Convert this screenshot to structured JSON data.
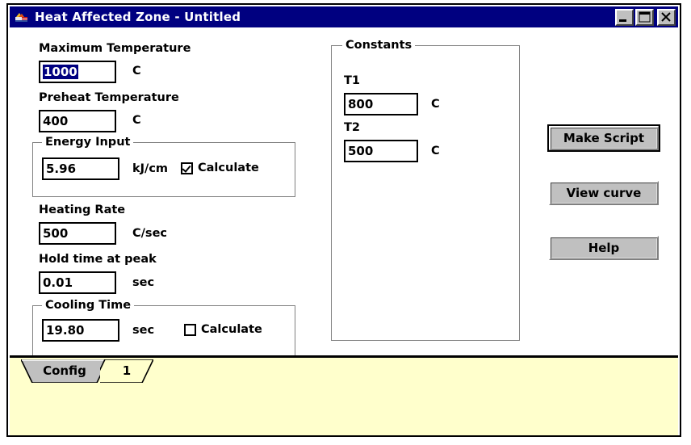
{
  "window": {
    "title": "Heat Affected Zone - Untitled",
    "icon": "welding-flag-icon",
    "controls": {
      "minimize": "minimize-icon",
      "maximize": "maximize-icon",
      "close": "close-icon"
    }
  },
  "colors": {
    "titlebar": "#000080",
    "selection": "#000080",
    "button_face": "#c0c0c0",
    "tab_pane": "#ffffcc",
    "client": "#ffffff",
    "group_border": "#808080"
  },
  "form": {
    "maximum_temperature": {
      "label": "Maximum Temperature",
      "value": "1000",
      "unit": "C",
      "selected": true
    },
    "preheat_temperature": {
      "label": "Preheat Temperature",
      "value": "400",
      "unit": "C"
    },
    "energy_input": {
      "group_label": "Energy Input",
      "value": "5.96",
      "unit": "kJ/cm",
      "calculate_label": "Calculate",
      "calculate_checked": true
    },
    "heating_rate": {
      "label": "Heating Rate",
      "value": "500",
      "unit": "C/sec"
    },
    "hold_time": {
      "label": "Hold time at peak",
      "value": "0.01",
      "unit": "sec"
    },
    "cooling_time": {
      "group_label": "Cooling Time",
      "value": "19.80",
      "unit": "sec",
      "calculate_label": "Calculate",
      "calculate_checked": false
    }
  },
  "constants": {
    "group_label": "Constants",
    "t1": {
      "label": "T1",
      "value": "800",
      "unit": "C"
    },
    "t2": {
      "label": "T2",
      "value": "500",
      "unit": "C"
    }
  },
  "buttons": {
    "make_script": "Make Script",
    "view_curve": "View curve",
    "help": "Help"
  },
  "tabs": [
    {
      "label": "Config",
      "active": true
    },
    {
      "label": "1",
      "active": false
    }
  ]
}
